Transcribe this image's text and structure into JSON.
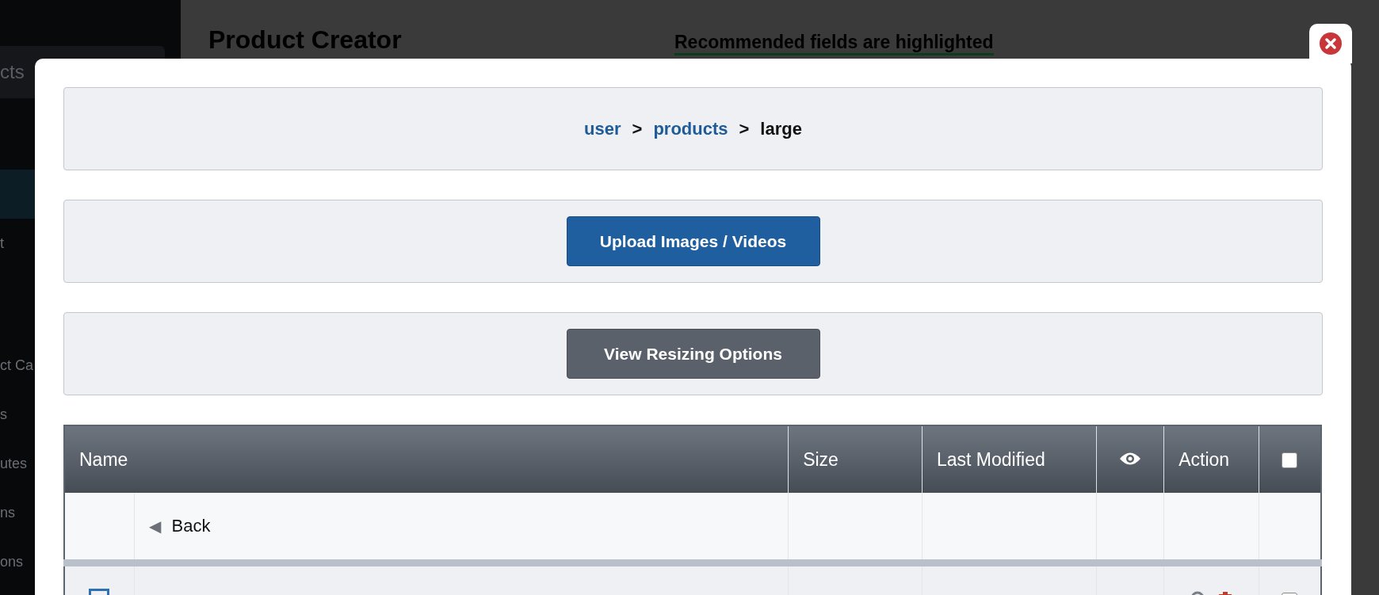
{
  "background": {
    "sidebar": {
      "search": "cts",
      "items": [
        {
          "selected": true
        },
        {
          "label": "t",
          "selected": false
        },
        {
          "label": "ct Ca",
          "selected": false
        },
        {
          "label": "s",
          "selected": false
        },
        {
          "label": "utes",
          "selected": false
        },
        {
          "label": "ns",
          "selected": false
        },
        {
          "label": "ons",
          "selected": false
        }
      ]
    },
    "page_title": "Product Creator",
    "notice": "Recommended fields are highlighted"
  },
  "modal": {
    "breadcrumb": [
      {
        "kind": "link",
        "text": "user"
      },
      {
        "kind": "separator",
        "text": ">"
      },
      {
        "kind": "link",
        "text": "products"
      },
      {
        "kind": "separator",
        "text": ">"
      },
      {
        "kind": "current",
        "text": "large"
      }
    ],
    "buttons": [
      {
        "kind": "primary",
        "label": "Upload Images / Videos"
      },
      {
        "kind": "secondary",
        "label": "View Resizing Options"
      }
    ],
    "table": {
      "columns": [
        {
          "kind": "text",
          "label": "Name"
        },
        {
          "kind": "text",
          "label": "Size"
        },
        {
          "kind": "text",
          "label": "Last Modified"
        },
        {
          "kind": "eye"
        },
        {
          "kind": "text",
          "label": "Action"
        },
        {
          "kind": "checkbox",
          "checked": false
        }
      ],
      "rows": [
        {
          "kind": "back",
          "icon": "◀",
          "label": "Back"
        },
        {
          "kind": "file",
          "checked": false
        }
      ]
    }
  }
}
